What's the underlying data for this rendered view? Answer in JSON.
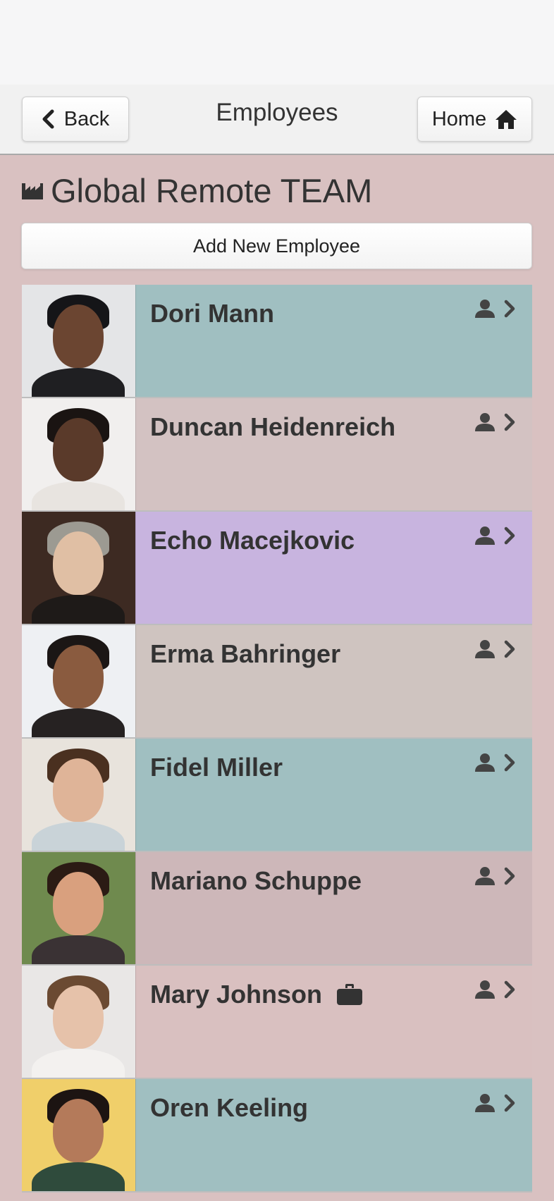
{
  "header": {
    "title": "Employees",
    "back_label": "Back",
    "home_label": "Home"
  },
  "team": {
    "title": "Global Remote TEAM",
    "add_button_label": "Add New Employee"
  },
  "employees": [
    {
      "name": "Dori Mann",
      "color": "#a0bfc1",
      "badge": false
    },
    {
      "name": "Duncan Heidenreich",
      "color": "#d3c2c2",
      "badge": false
    },
    {
      "name": "Echo Macejkovic",
      "color": "#c8b4df",
      "badge": false
    },
    {
      "name": "Erma Bahringer",
      "color": "#cfc4c0",
      "badge": false
    },
    {
      "name": "Fidel Miller",
      "color": "#a0bfc1",
      "badge": false
    },
    {
      "name": "Mariano Schuppe",
      "color": "#cdb7b9",
      "badge": false
    },
    {
      "name": "Mary Johnson",
      "color": "#d9c0c0",
      "badge": true,
      "badge_icon": "briefcase-icon"
    },
    {
      "name": "Oren Keeling",
      "color": "#a0bfc1",
      "badge": false
    }
  ],
  "icons": {
    "row_person": "person-icon",
    "row_chevron": "chevron-right-icon",
    "team": "factory-icon",
    "back": "chevron-left-icon",
    "home": "home-icon"
  }
}
